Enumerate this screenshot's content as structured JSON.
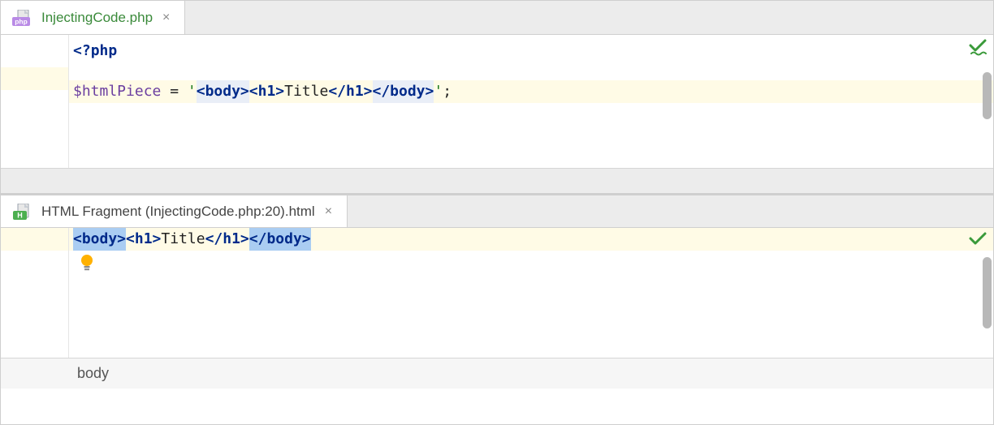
{
  "top_editor": {
    "tab": {
      "label": "InjectingCode.php",
      "icon": "php-file-icon"
    },
    "code": {
      "line1": {
        "open": "<?",
        "kw": "php"
      },
      "line2": {
        "var": "$htmlPiece",
        "eq": " = ",
        "q1": "'",
        "body_o": "<body>",
        "h1_o": "<h1>",
        "title": "Title",
        "h1_c": "</h1>",
        "body_c": "</body>",
        "q2": "'",
        "semi": ";"
      }
    }
  },
  "bottom_editor": {
    "tab": {
      "label": "HTML Fragment (InjectingCode.php:20).html",
      "icon": "html-file-icon"
    },
    "code": {
      "line1": {
        "body_o": "<body>",
        "h1_o": "<h1>",
        "title": "Title",
        "h1_c": "</h1>",
        "body_c": "</body>"
      }
    },
    "breadcrumb": "body"
  }
}
